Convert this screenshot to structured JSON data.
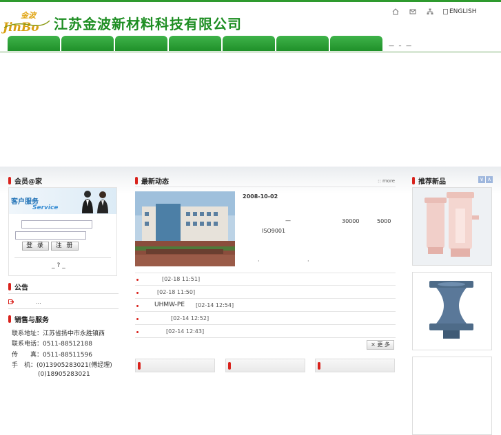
{
  "header": {
    "company_name": "江苏金波新材料科技有限公司",
    "logo_text": "JinBo",
    "english_link": "ENGLISH",
    "nav_extra": "—  –  —"
  },
  "member": {
    "title": "会员@家",
    "service_cn": "客户服务",
    "service_en": "Service",
    "login_label": "登 录",
    "register_label": "注 册",
    "forgot_label": "_?_"
  },
  "notice": {
    "title": "公告",
    "item_text": "..."
  },
  "sales": {
    "title": "销售与服务",
    "lines": [
      "联系地址：江苏省扬中市永胜镇西",
      "联系电话：0511-88512188",
      "传　　真：0511-88511596",
      "手　机：(0)13905283021(傅经理)",
      "(0)18905283021"
    ]
  },
  "news": {
    "title": "最新动态",
    "more_link": "::  more",
    "featured_date": "2008-10-02",
    "featured_texts": [
      "—",
      "30000",
      "5000",
      "ISO9001",
      "·",
      "·"
    ],
    "items": [
      {
        "title": "",
        "time": "[02-18 11:51]"
      },
      {
        "title": "",
        "time": "[02-18 11:50]"
      },
      {
        "title": "UHMW-PE",
        "time": "[02-14 12:54]"
      },
      {
        "title": "",
        "time": "[02-14 12:52]"
      },
      {
        "title": "",
        "time": "[02-14 12:43]"
      }
    ],
    "more_button": "× 更 多"
  },
  "products": {
    "title": "推荐新品",
    "arrow_up": "∨",
    "arrow_down": "∧"
  },
  "colors": {
    "brand_green": "#1e8e23",
    "accent_red": "#d9221c"
  }
}
